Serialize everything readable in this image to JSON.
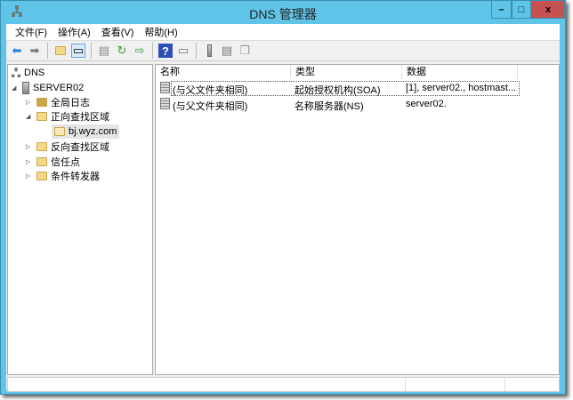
{
  "window": {
    "title": "DNS 管理器",
    "minimize": "–",
    "maximize": "□",
    "close": "x"
  },
  "menu": [
    "文件(F)",
    "操作(A)",
    "查看(V)",
    "帮助(H)"
  ],
  "tree": {
    "root": "DNS",
    "server": "SERVER02",
    "items": [
      "全局日志",
      "正向查找区域",
      "bj.wyz.com",
      "反向查找区域",
      "信任点",
      "条件转发器"
    ]
  },
  "list": {
    "columns": [
      "名称",
      "类型",
      "数据"
    ],
    "rows": [
      {
        "name": "(与父文件夹相同)",
        "type": "起始授权机构(SOA)",
        "data": "[1], server02., hostmast..."
      },
      {
        "name": "(与父文件夹相同)",
        "type": "名称服务器(NS)",
        "data": "server02."
      }
    ]
  }
}
